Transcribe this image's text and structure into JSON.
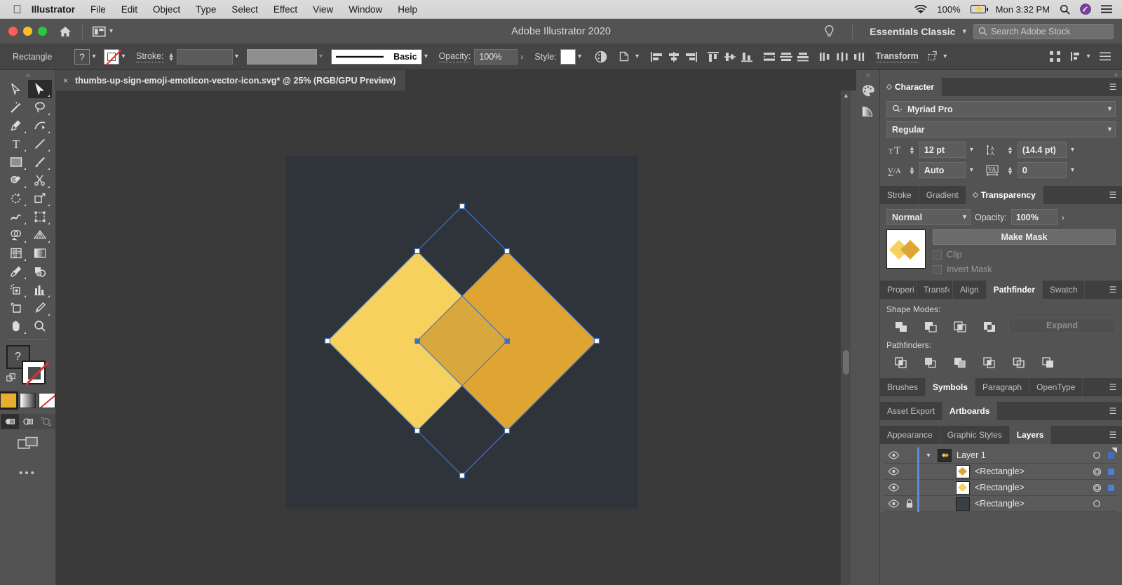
{
  "macbar": {
    "apple": "apple-logo",
    "items": [
      "Illustrator",
      "File",
      "Edit",
      "Object",
      "Type",
      "Select",
      "Effect",
      "View",
      "Window",
      "Help"
    ],
    "battery_percent": "100%",
    "clock": "Mon 3:32 PM"
  },
  "window": {
    "title": "Adobe Illustrator 2020",
    "workspace": "Essentials Classic",
    "search_placeholder": "Search Adobe Stock",
    "arrange_label": "arrange-documents"
  },
  "control": {
    "object_label": "Rectangle",
    "fill_value": "?",
    "stroke_label": "Stroke:",
    "stroke_weight": "",
    "stroke_profile": "",
    "brush_label": "Basic",
    "opacity_label": "Opacity:",
    "opacity_value": "100%",
    "style_label": "Style:",
    "transform_label": "Transform"
  },
  "document": {
    "tab_title": "thumbs-up-sign-emoji-emoticon-vector-icon.svg* @ 25% (RGB/GPU Preview)",
    "close_label": "×"
  },
  "tools": [
    {
      "name": "selection-tool",
      "active": false
    },
    {
      "name": "direct-selection-tool",
      "active": true
    },
    {
      "name": "magic-wand-tool",
      "active": false
    },
    {
      "name": "lasso-tool",
      "active": false
    },
    {
      "name": "pen-tool",
      "active": false
    },
    {
      "name": "curvature-tool",
      "active": false
    },
    {
      "name": "type-tool",
      "active": false
    },
    {
      "name": "line-segment-tool",
      "active": false
    },
    {
      "name": "rectangle-tool",
      "active": false
    },
    {
      "name": "paintbrush-tool",
      "active": false
    },
    {
      "name": "shaper-tool",
      "active": false
    },
    {
      "name": "scissors-tool",
      "active": false
    },
    {
      "name": "rotate-tool",
      "active": false
    },
    {
      "name": "scale-tool",
      "active": false
    },
    {
      "name": "width-tool",
      "active": false
    },
    {
      "name": "free-transform-tool",
      "active": false
    },
    {
      "name": "shape-builder-tool",
      "active": false
    },
    {
      "name": "perspective-grid-tool",
      "active": false
    },
    {
      "name": "mesh-tool",
      "active": false
    },
    {
      "name": "gradient-tool",
      "active": false
    },
    {
      "name": "eyedropper-tool",
      "active": false
    },
    {
      "name": "blend-tool",
      "active": false
    },
    {
      "name": "symbol-sprayer-tool",
      "active": false
    },
    {
      "name": "column-graph-tool",
      "active": false
    },
    {
      "name": "artboard-tool",
      "active": false
    },
    {
      "name": "slice-tool",
      "active": false
    },
    {
      "name": "hand-tool",
      "active": false
    },
    {
      "name": "zoom-tool",
      "active": false
    }
  ],
  "toolbar_bottom": {
    "fill_color": "#E8AE2E",
    "fill_value": "?",
    "stroke_none": true,
    "swatch_buttons": [
      "color-swatch",
      "gradient-swatch",
      "none-swatch"
    ],
    "draw_modes": [
      "draw-normal",
      "draw-behind",
      "draw-inside"
    ],
    "screen_mode": "change-screen-mode",
    "more_label": "•••"
  },
  "artwork": {
    "canvas_bg": "#3A3A3A",
    "artboard_bg": "#2F343A",
    "shape_light": "#F7D15E",
    "shape_dark": "#E0A433",
    "overlap": "#D8A83E",
    "selection_color": "#3D6FC4"
  },
  "panels": {
    "character": {
      "tab": "Character",
      "font_family": "Myriad Pro",
      "font_style": "Regular",
      "font_size": "12 pt",
      "leading": "(14.4 pt)",
      "kerning": "Auto",
      "tracking": "0"
    },
    "transparency_group": {
      "tabs": [
        "Stroke",
        "Gradient",
        "Transparency"
      ],
      "active": "Transparency",
      "blend_mode": "Normal",
      "opacity_label": "Opacity:",
      "opacity_value": "100%",
      "make_mask": "Make Mask",
      "clip": "Clip",
      "invert_mask": "Invert Mask"
    },
    "pathfinder_group": {
      "tabs": [
        "Properi",
        "Transf‹",
        "Align",
        "Pathfinder",
        "Swatch"
      ],
      "active": "Pathfinder",
      "shape_modes_label": "Shape Modes:",
      "expand_label": "Expand",
      "pathfinders_label": "Pathfinders:",
      "shape_modes": [
        "unite",
        "minus-front",
        "intersect",
        "exclude"
      ],
      "pathfinders": [
        "divide",
        "trim",
        "merge",
        "crop",
        "outline",
        "minus-back"
      ]
    },
    "symbols_group": {
      "tabs": [
        "Brushes",
        "Symbols",
        "Paragraph",
        "OpenType"
      ],
      "active": "Symbols"
    },
    "artboards_group": {
      "tabs": [
        "Asset Export",
        "Artboards"
      ],
      "active": "Artboards"
    },
    "layers_group": {
      "tabs": [
        "Appearance",
        "Graphic Styles",
        "Layers"
      ],
      "active": "Layers",
      "rows": [
        {
          "name": "Layer 1",
          "kind": "layer",
          "locked": false,
          "thumb": "layer-thumb",
          "selected": true,
          "target": "circle-empty"
        },
        {
          "name": "<Rectangle>",
          "kind": "object",
          "locked": false,
          "thumb": "#E0A433",
          "selected": true,
          "target": "circle-double"
        },
        {
          "name": "<Rectangle>",
          "kind": "object",
          "locked": false,
          "thumb": "#F7D15E",
          "selected": true,
          "target": "circle-double"
        },
        {
          "name": "<Rectangle>",
          "kind": "object",
          "locked": true,
          "thumb": "#3A3F45",
          "selected": false,
          "target": "circle-empty"
        }
      ]
    }
  }
}
